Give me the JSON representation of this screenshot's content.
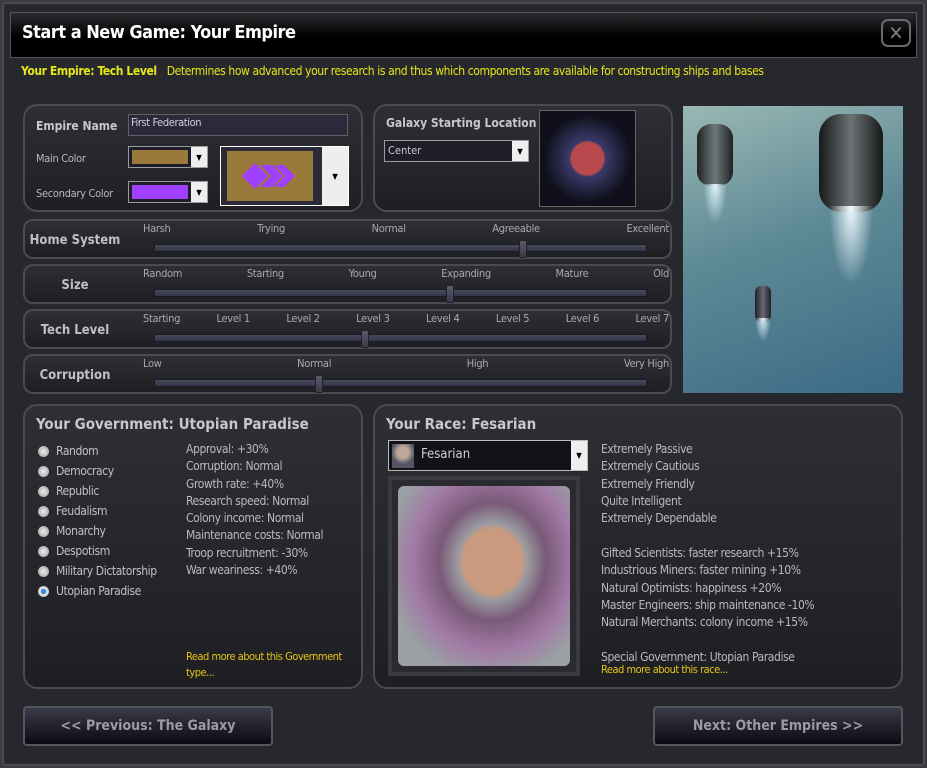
{
  "window": {
    "title": "Start a New Game: Your Empire",
    "close_icon": "close-icon"
  },
  "hint": {
    "label": "Your Empire: Tech Level",
    "text": "Determines how advanced your research is and thus which components are available for constructing ships and bases"
  },
  "empire": {
    "name_label": "Empire Name",
    "name_value": "First Federation",
    "main_color_label": "Main Color",
    "main_color": "#9a7a3a",
    "secondary_color_label": "Secondary Color",
    "secondary_color": "#a040ff"
  },
  "galaxy": {
    "label": "Galaxy Starting Location",
    "value": "Center"
  },
  "sliders": [
    {
      "name": "Home System",
      "options": [
        "Harsh",
        "Trying",
        "Normal",
        "Agreeable",
        "Excellent"
      ],
      "selected": 3
    },
    {
      "name": "Size",
      "options": [
        "Random",
        "Starting",
        "Young",
        "Expanding",
        "Mature",
        "Old"
      ],
      "selected": 3
    },
    {
      "name": "Tech Level",
      "options": [
        "Starting",
        "Level 1",
        "Level 2",
        "Level 3",
        "Level 4",
        "Level 5",
        "Level 6",
        "Level 7"
      ],
      "selected": 3
    },
    {
      "name": "Corruption",
      "options": [
        "Low",
        "Normal",
        "High",
        "Very High"
      ],
      "selected": 1
    }
  ],
  "government": {
    "title": "Your Government: Utopian Paradise",
    "options": [
      "Random",
      "Democracy",
      "Republic",
      "Feudalism",
      "Monarchy",
      "Despotism",
      "Military Dictatorship",
      "Utopian Paradise"
    ],
    "selected": 7,
    "stats": [
      "Approval: +30%",
      "Corruption: Normal",
      "Growth rate: +40%",
      "Research speed: Normal",
      "Colony income: Normal",
      "Maintenance costs: Normal",
      "Troop recruitment: -30%",
      "War weariness: +40%"
    ],
    "link": "Read more about this Government type..."
  },
  "race": {
    "title": "Your Race: Fesarian",
    "selected": "Fesarian",
    "traits": [
      "Extremely Passive",
      "Extremely Cautious",
      "Extremely Friendly",
      "Quite Intelligent",
      "Extremely Dependable"
    ],
    "bonuses": [
      "Gifted Scientists: faster research +15%",
      "Industrious Miners: faster mining +10%",
      "Natural Optimists: happiness +20%",
      "Master Engineers: ship maintenance -10%",
      "Natural Merchants: colony income +15%"
    ],
    "special": "Special Government: Utopian Paradise",
    "link": "Read more about this race..."
  },
  "nav": {
    "previous": "<< Previous: The Galaxy",
    "next": "Next: Other Empires >>"
  }
}
